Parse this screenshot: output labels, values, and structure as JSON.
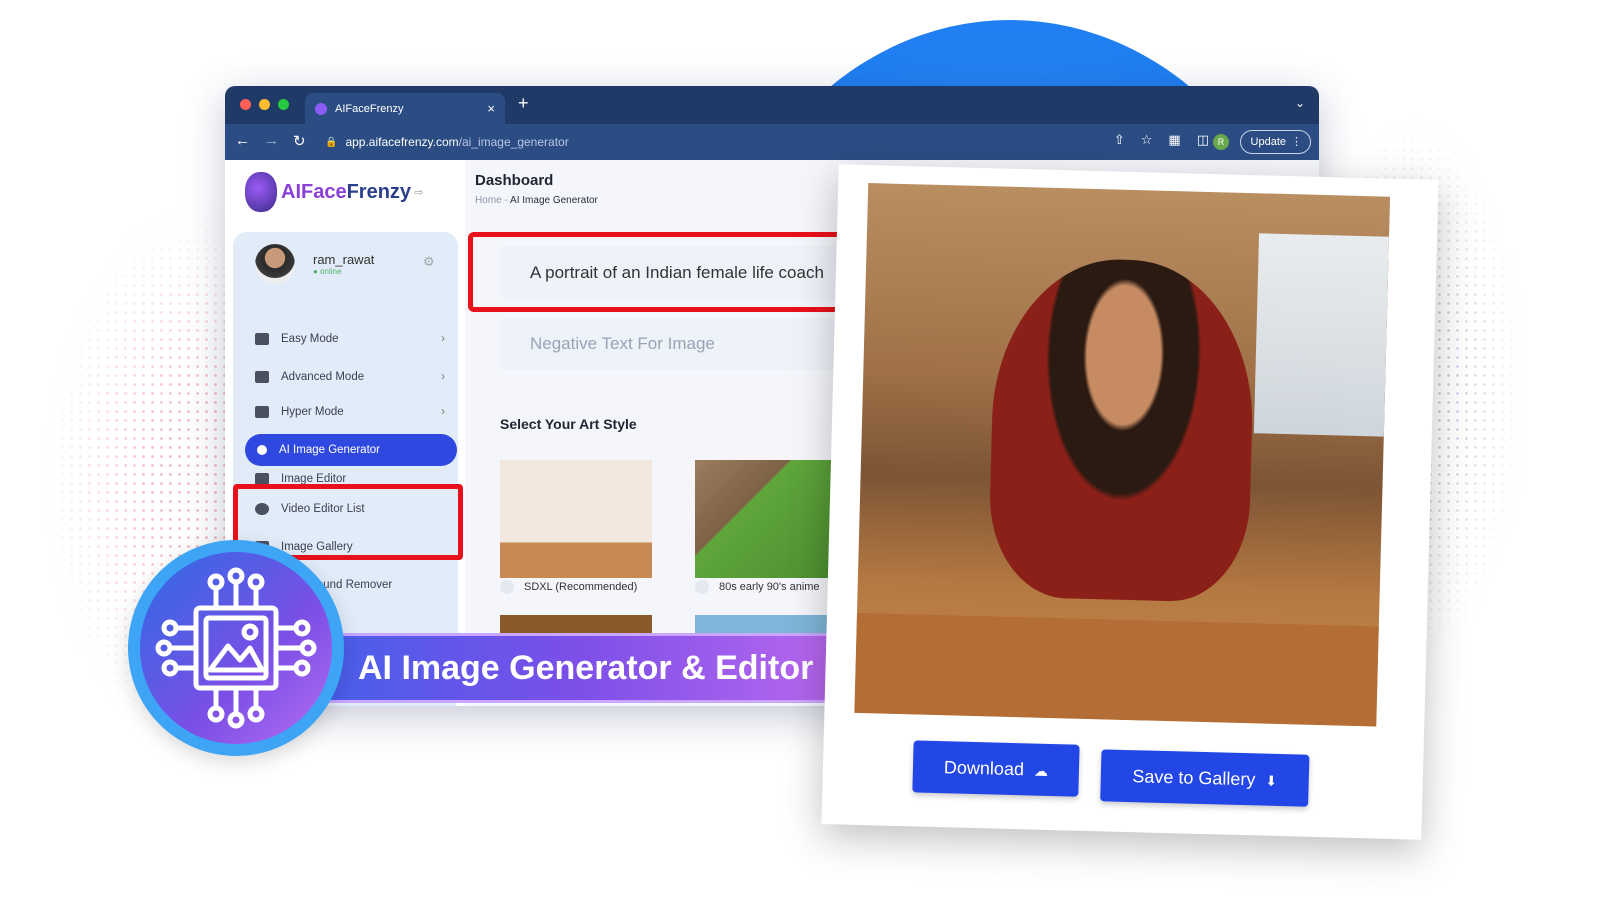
{
  "browser": {
    "tab_title": "AIFaceFrenzy",
    "url_host": "app.aifacefrenzy.com",
    "url_path": "/ai_image_generator",
    "profile_initial": "R",
    "update_label": "Update",
    "new_tab": "+",
    "close_tab": "×"
  },
  "logo": {
    "part1": "AIFace",
    "part2": "Frenzy"
  },
  "user": {
    "name": "ram_rawat",
    "status": "● online"
  },
  "sidebar": {
    "items": [
      {
        "label": "Easy Mode"
      },
      {
        "label": "Advanced Mode"
      },
      {
        "label": "Hyper Mode"
      },
      {
        "label": "AI Image Generator"
      },
      {
        "label": "Image Editor"
      },
      {
        "label": "Video Editor List"
      },
      {
        "label": "Image Gallery"
      },
      {
        "label": "Background Remover"
      }
    ]
  },
  "header": {
    "title": "Dashboard",
    "crumb_home": "Home",
    "crumb_sep": "-",
    "crumb_current": "AI Image Generator"
  },
  "prompt": {
    "value": "A portrait of an Indian female life coach"
  },
  "negative": {
    "placeholder": "Negative Text For Image"
  },
  "art": {
    "heading": "Select Your Art Style",
    "styles": [
      {
        "label": "SDXL (Recommended)"
      },
      {
        "label": "80s early 90's anime"
      }
    ]
  },
  "banner": {
    "text": "AI Image Generator & Editor"
  },
  "card": {
    "download": "Download",
    "save": "Save to Gallery"
  },
  "colors": {
    "accent": "#2346e6",
    "highlight": "#e8101a",
    "browser_chrome": "#1f3a67"
  }
}
